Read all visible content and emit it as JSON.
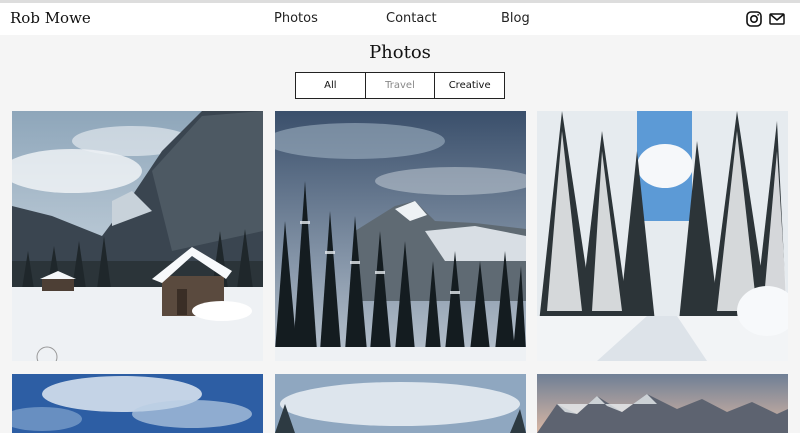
{
  "brand": "Rob Mowe",
  "nav": [
    {
      "label": "Photos"
    },
    {
      "label": "Contact"
    },
    {
      "label": "Blog"
    }
  ],
  "icons": [
    "instagram-icon",
    "mail-icon"
  ],
  "page_title": "Photos",
  "filters": [
    {
      "label": "All",
      "active": true
    },
    {
      "label": "Travel",
      "active": false
    },
    {
      "label": "Creative",
      "active": true
    }
  ],
  "gallery": [
    {
      "subject": "snowy cabin in alpine valley"
    },
    {
      "subject": "snowy fir trees and mountain peak under cloudy sky"
    },
    {
      "subject": "snow covered forest path"
    },
    {
      "subject": "blue sky with clouds"
    },
    {
      "subject": "misty mountain landscape"
    },
    {
      "subject": "rocky mountain range at sunset"
    }
  ]
}
